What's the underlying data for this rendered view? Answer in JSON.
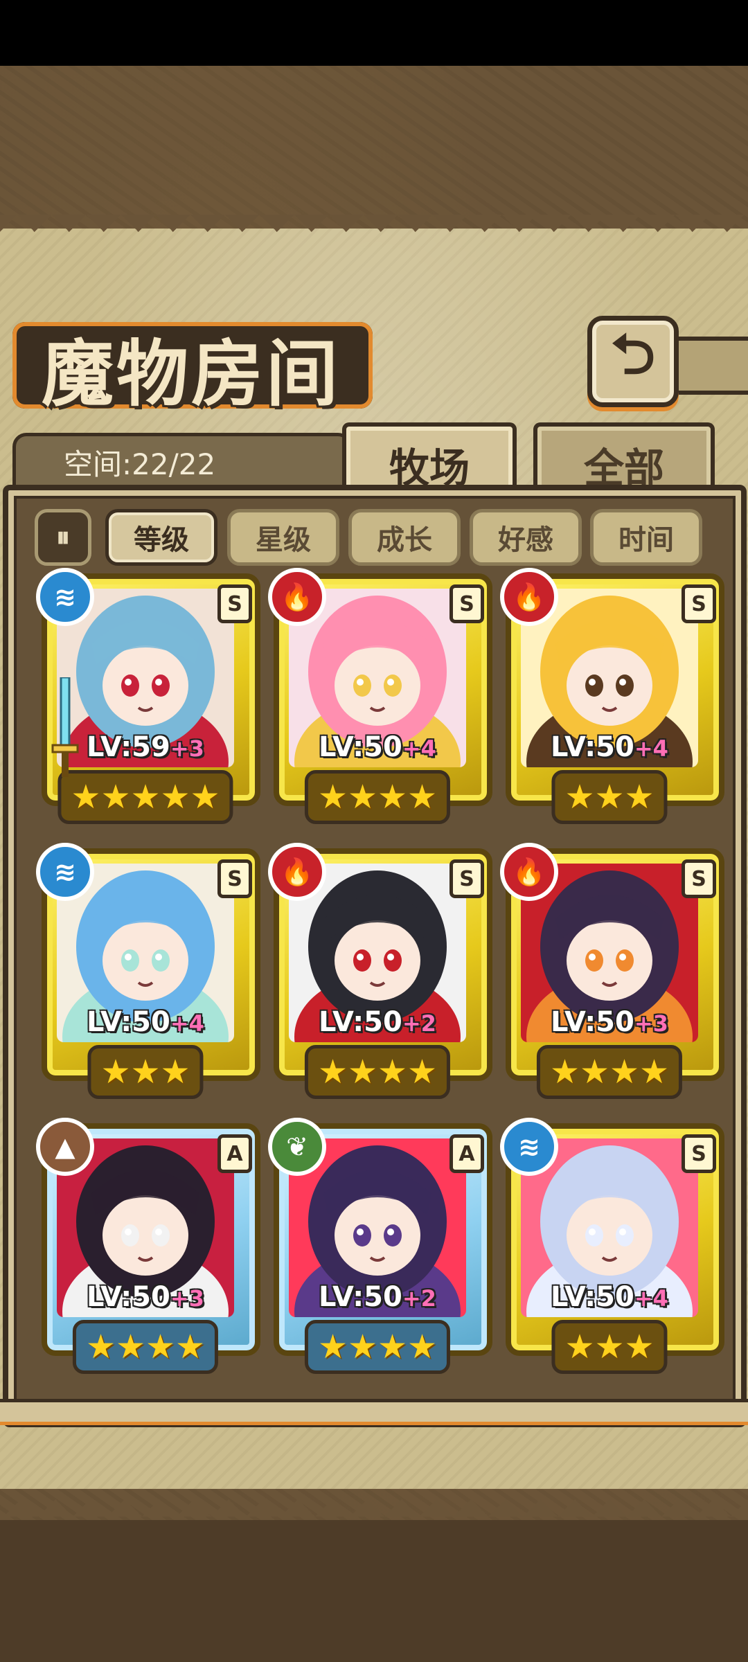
{
  "title": "魔物房间",
  "space_label": "空间:22/22",
  "tabs": [
    {
      "label": "牧场",
      "active": true
    },
    {
      "label": "全部",
      "active": false
    }
  ],
  "sort_toggle": "⏸",
  "sort_buttons": [
    {
      "label": "等级",
      "active": true
    },
    {
      "label": "星级",
      "active": false
    },
    {
      "label": "成长",
      "active": false
    },
    {
      "label": "好感",
      "active": false
    },
    {
      "label": "时间",
      "active": false
    }
  ],
  "monsters": [
    {
      "level": "LV:59",
      "plus": "+3",
      "rank": "S",
      "element": "water",
      "element_icon": "water-icon",
      "stars": "★★★★★",
      "frame": "gold",
      "equipped": true,
      "palette": [
        "#7ab8d8",
        "#c8223a",
        "#f2e2d6"
      ]
    },
    {
      "level": "LV:50",
      "plus": "+4",
      "rank": "S",
      "element": "fire",
      "element_icon": "fire-icon",
      "stars": "★★★★",
      "frame": "gold",
      "equipped": false,
      "palette": [
        "#ff8fb0",
        "#f2c84a",
        "#f8e0e8"
      ]
    },
    {
      "level": "LV:50",
      "plus": "+4",
      "rank": "S",
      "element": "fire",
      "element_icon": "fire-icon",
      "stars": "★★★",
      "frame": "gold",
      "equipped": false,
      "palette": [
        "#f7c23a",
        "#5a3a20",
        "#fff2c0"
      ]
    },
    {
      "level": "LV:50",
      "plus": "+4",
      "rank": "S",
      "element": "water",
      "element_icon": "water-icon",
      "stars": "★★★",
      "frame": "gold",
      "equipped": false,
      "palette": [
        "#6ab4ea",
        "#a8e4d8",
        "#f4eee0"
      ]
    },
    {
      "level": "LV:50",
      "plus": "+2",
      "rank": "S",
      "element": "fire",
      "element_icon": "fire-icon",
      "stars": "★★★★",
      "frame": "gold",
      "equipped": false,
      "palette": [
        "#2a2a32",
        "#c8202a",
        "#f2f2f2"
      ]
    },
    {
      "level": "LV:50",
      "plus": "+3",
      "rank": "S",
      "element": "fire",
      "element_icon": "fire-icon",
      "stars": "★★★★",
      "frame": "gold",
      "equipped": false,
      "palette": [
        "#3a2a4a",
        "#f08a30",
        "#c8202a"
      ]
    },
    {
      "level": "LV:50",
      "plus": "+3",
      "rank": "A",
      "element": "earth",
      "element_icon": "earth-icon",
      "stars": "★★★★",
      "frame": "silver",
      "equipped": false,
      "palette": [
        "#2a1f2e",
        "#f2f2f2",
        "#c82040"
      ]
    },
    {
      "level": "LV:50",
      "plus": "+2",
      "rank": "A",
      "element": "wood",
      "element_icon": "leaf-icon",
      "stars": "★★★★",
      "frame": "silver",
      "equipped": false,
      "palette": [
        "#3a2a5a",
        "#5a3a8a",
        "#ff3a5a"
      ]
    },
    {
      "level": "LV:50",
      "plus": "+4",
      "rank": "S",
      "element": "water",
      "element_icon": "water-icon",
      "stars": "★★★",
      "frame": "gold",
      "equipped": false,
      "palette": [
        "#c8d4f2",
        "#e8eefe",
        "#ff6a8a"
      ]
    }
  ],
  "colors": {
    "accent": "#e28a2e",
    "dark": "#3b2e20",
    "parchment": "#cbbd8e"
  }
}
